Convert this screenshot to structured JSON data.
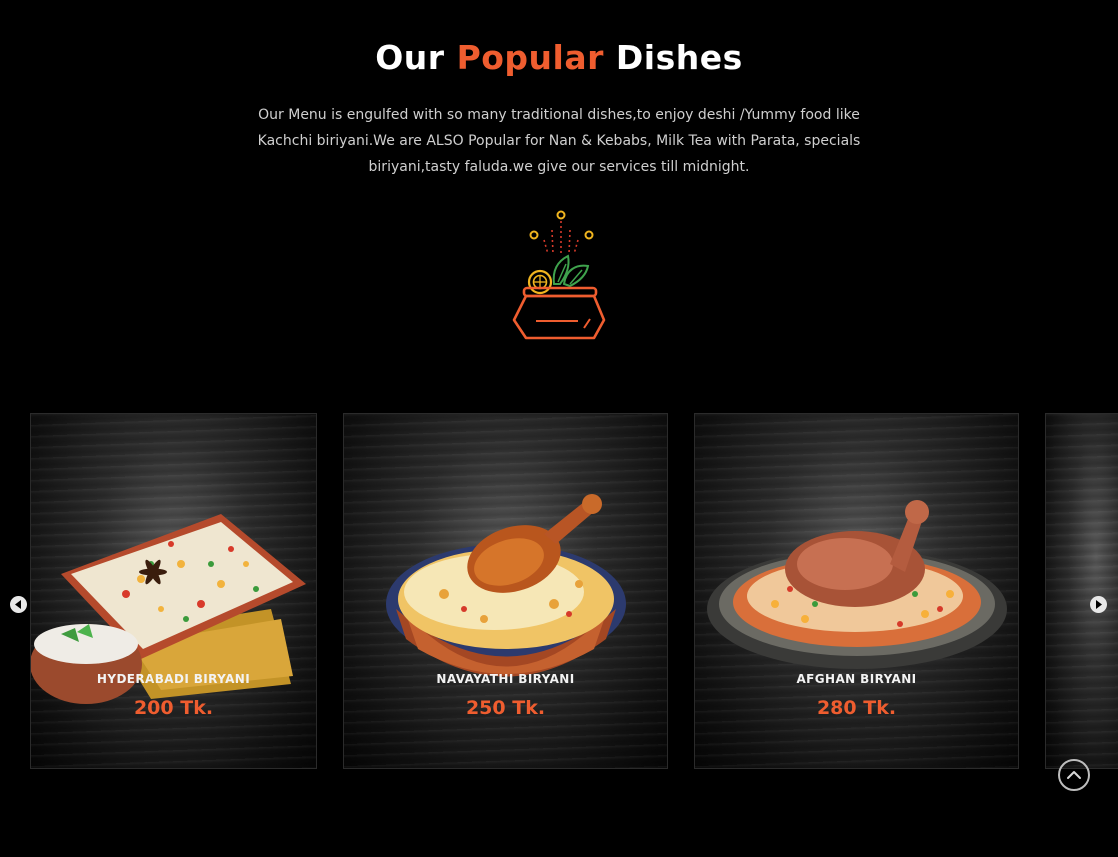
{
  "section": {
    "title_part1": "Our",
    "title_accent": "Popular",
    "title_part2": "Dishes",
    "intro_text": "Our Menu is engulfed with so many traditional dishes,to enjoy deshi /Yummy food like Kachchi biriyani.We are ALSO Popular for Nan & Kebabs, Milk Tea with Parata, specials biriyani,tasty faluda.we give our services till midnight."
  },
  "dishes": [
    {
      "name": "HYDERABADI BIRYANI",
      "price": "200 Tk."
    },
    {
      "name": "NAVAYATHI BIRYANI",
      "price": "250 Tk."
    },
    {
      "name": "AFGHAN BIRYANI",
      "price": "280 Tk."
    }
  ],
  "icons": {
    "decor": "biryani-pot-icon",
    "prev": "arrow-left-icon",
    "next": "arrow-right-icon",
    "top": "chevron-up-icon"
  },
  "colors": {
    "accent": "#ef5d2f",
    "background": "#000000",
    "price": "#ef5d2f",
    "icon_yellow": "#f1b51f"
  }
}
